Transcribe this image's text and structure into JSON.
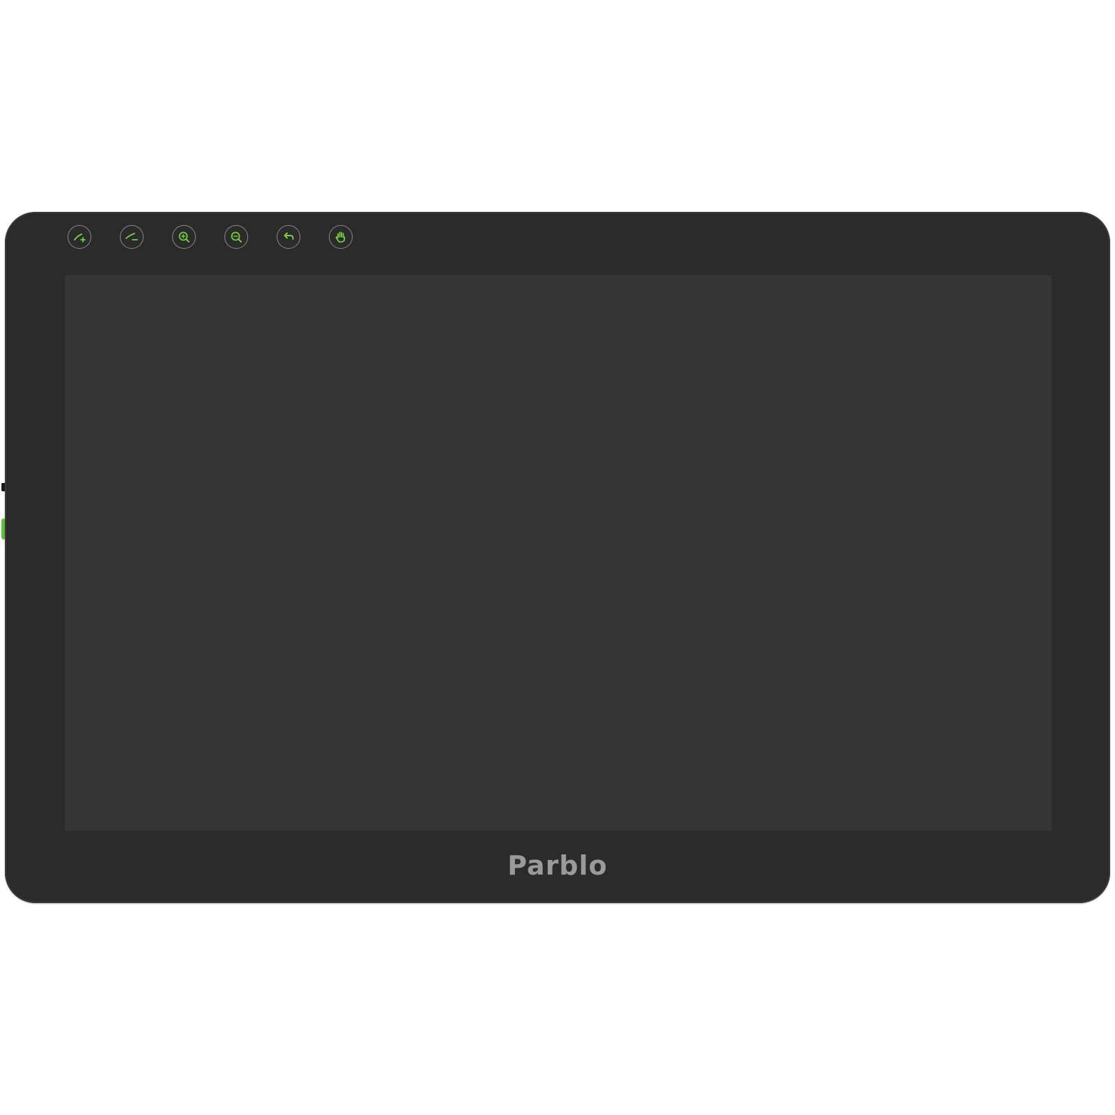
{
  "device": {
    "brand_label": "Parblo",
    "accent_color": "#6fd13f",
    "body_color": "#2b2b2b",
    "screen_color": "#353535"
  },
  "hotkeys": [
    {
      "icon": "brush-size-increase-icon"
    },
    {
      "icon": "brush-size-decrease-icon"
    },
    {
      "icon": "zoom-in-icon"
    },
    {
      "icon": "zoom-out-icon"
    },
    {
      "icon": "undo-icon"
    },
    {
      "icon": "hand-pan-icon"
    }
  ]
}
